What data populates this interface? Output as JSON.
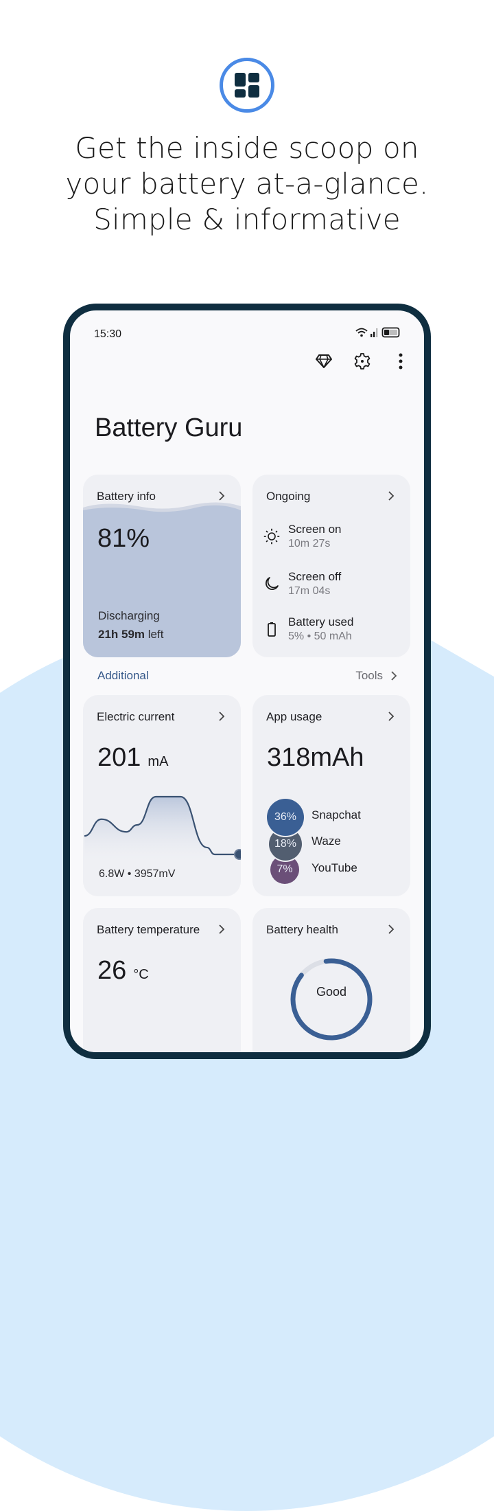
{
  "hero": {
    "icon": "dashboard-grid-icon",
    "headline_lines": [
      "Get the inside scoop on",
      "your battery at-a-glance.",
      "Simple & informative"
    ]
  },
  "colors": {
    "accent": "#4a8ae6",
    "frame": "#0f2e40",
    "background_shape": "#d6ebfc",
    "card": "#eff0f4",
    "battery_fill": "#b9c5db",
    "primary_blue": "#3a5f94",
    "link_blue": "#36598a"
  },
  "status_bar": {
    "time": "15:30",
    "icons": [
      "wifi-icon",
      "signal-icon",
      "battery-icon"
    ]
  },
  "toolbar": {
    "icons": [
      "diamond-premium-icon",
      "settings-gear-icon",
      "more-vert-icon"
    ]
  },
  "app_title": "Battery Guru",
  "battery_info": {
    "title": "Battery info",
    "level_text": "81%",
    "level_percent": 81,
    "state": "Discharging",
    "time_left_bold": "21h 59m",
    "time_left_suffix": " left"
  },
  "ongoing": {
    "title": "Ongoing",
    "rows": [
      {
        "icon": "brightness-sun-icon",
        "label": "Screen on",
        "value": "10m 27s"
      },
      {
        "icon": "moon-icon",
        "label": "Screen off",
        "value": "17m 04s"
      },
      {
        "icon": "battery-outline-icon",
        "label": "Battery used",
        "value": "5% • 50 mAh"
      }
    ]
  },
  "section": {
    "left_label": "Additional",
    "right_label": "Tools"
  },
  "electric_current": {
    "title": "Electric current",
    "value": "201",
    "unit": "mA",
    "meta": "6.8W  •  3957mV",
    "chart_data": {
      "type": "line",
      "title": "Electric current",
      "x": [
        0,
        1,
        2,
        3,
        4,
        5,
        6,
        7,
        8
      ],
      "values": [
        0.32,
        0.61,
        0.39,
        0.51,
        1.0,
        1.0,
        0.12,
        0.0,
        0.0
      ],
      "ylim": [
        0,
        1
      ],
      "xlabel": "",
      "ylabel": "",
      "grid": false,
      "end_marker": true
    }
  },
  "app_usage": {
    "title": "App usage",
    "total": "318mAh",
    "apps": [
      {
        "name": "Snapchat",
        "percent_text": "36%",
        "percent": 36,
        "color": "#3a5f94"
      },
      {
        "name": "Waze",
        "percent_text": "18%",
        "percent": 18,
        "color": "#525e70"
      },
      {
        "name": "YouTube",
        "percent_text": "7%",
        "percent": 7,
        "color": "#6b4f78"
      }
    ]
  },
  "battery_temperature": {
    "title": "Battery temperature",
    "value": "26",
    "unit": "°C"
  },
  "battery_health": {
    "title": "Battery health",
    "status": "Good",
    "gauge_fraction": 0.88
  }
}
